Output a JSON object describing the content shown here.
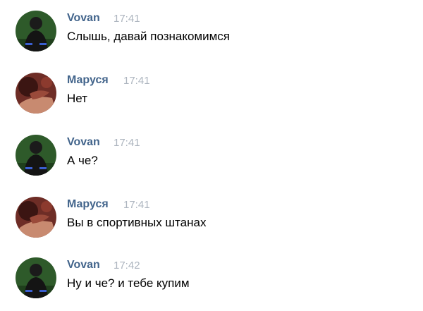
{
  "messages": [
    {
      "sender": "Vovan",
      "time": "17:41",
      "text": "Слышь, давай познакомимся",
      "avatar": "vovan-avatar"
    },
    {
      "sender": "Маруся",
      "time": "17:41",
      "text": "Нет",
      "avatar": "marusya-avatar"
    },
    {
      "sender": "Vovan",
      "time": "17:41",
      "text": "А че?",
      "avatar": "vovan-avatar"
    },
    {
      "sender": "Маруся",
      "time": "17:41",
      "text": "Вы в спортивных штанах",
      "avatar": "marusya-avatar"
    },
    {
      "sender": "Vovan",
      "time": "17:42",
      "text": "Ну и че? и тебе купим",
      "avatar": "vovan-avatar"
    }
  ],
  "colors": {
    "sender_name": "#42648b",
    "timestamp": "#adb5bf",
    "message_text": "#000000",
    "background": "#ffffff"
  }
}
